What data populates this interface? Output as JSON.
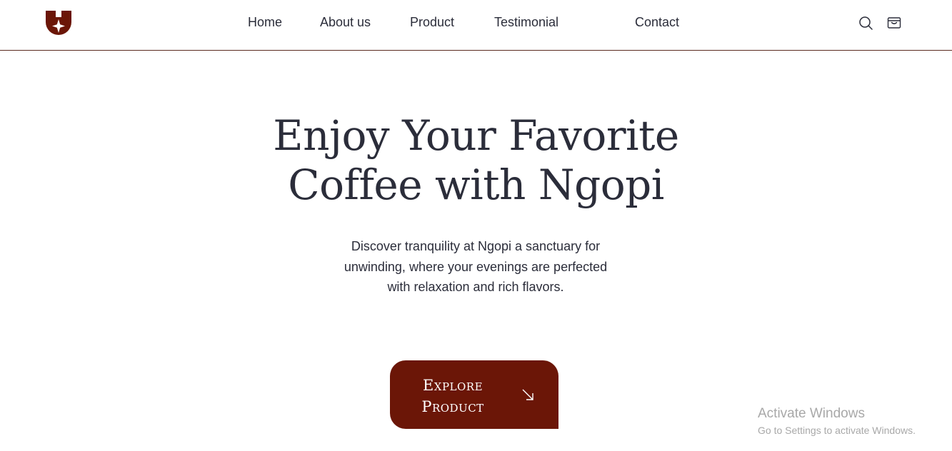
{
  "header": {
    "logo_icon": "ngopi-shield-star-logo",
    "nav": [
      {
        "label": "Home"
      },
      {
        "label": "About us"
      },
      {
        "label": "Product"
      },
      {
        "label": "Testimonial"
      },
      {
        "label": "Contact"
      }
    ],
    "icons": [
      "search-icon",
      "cart-icon"
    ]
  },
  "hero": {
    "title_line1": "Enjoy Your Favorite",
    "title_line2": "Coffee with Ngopi",
    "description": "Discover tranquility at Ngopi a sanctuary for unwinding, where your evenings are perfected with relaxation and rich flavors.",
    "cta": {
      "line1": "Explore",
      "line2": "Product",
      "icon": "arrow-down-right-icon"
    }
  },
  "watermark": {
    "title": "Activate Windows",
    "subtitle": "Go to Settings to activate Windows."
  },
  "colors": {
    "brand": "#6b1607",
    "text": "#2b2d3a",
    "divider": "#5a2a1f"
  }
}
